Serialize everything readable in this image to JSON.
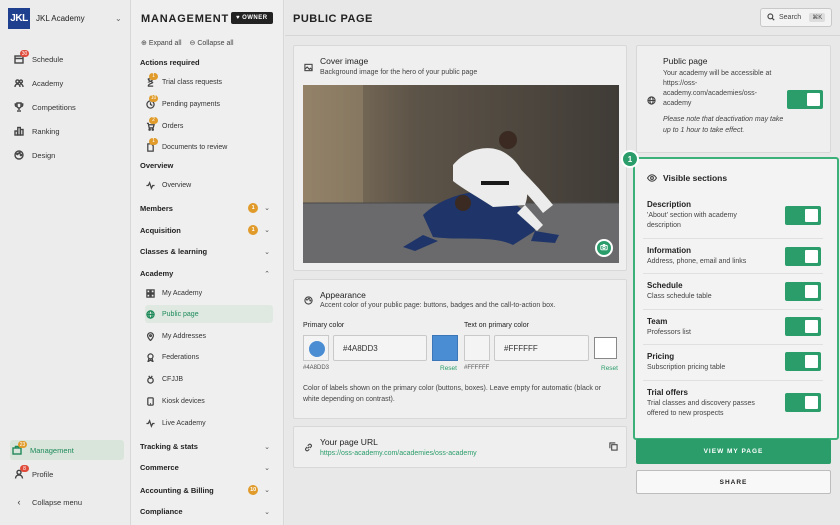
{
  "brand": {
    "logo_text": "JKL",
    "name": "JKL Academy"
  },
  "leftnav": [
    {
      "label": "Schedule",
      "badge": "30",
      "badge_color": "#e04a3a"
    },
    {
      "label": "Academy"
    },
    {
      "label": "Competitions"
    },
    {
      "label": "Ranking"
    },
    {
      "label": "Design"
    }
  ],
  "leftnav_bottom": {
    "management": {
      "label": "Management",
      "badge": "23"
    },
    "profile": {
      "label": "Profile",
      "badge": "8"
    },
    "collapse": {
      "label": "Collapse menu"
    }
  },
  "col2": {
    "title": "MANAGEMENT",
    "owner": "OWNER",
    "expand_all": "Expand all",
    "collapse_all": "Collapse all",
    "actions_label": "Actions required",
    "actions": [
      {
        "label": "Trial class requests",
        "badge": "1"
      },
      {
        "label": "Pending payments",
        "badge": "10"
      },
      {
        "label": "Orders",
        "badge": "2"
      },
      {
        "label": "Documents to review",
        "badge": "1"
      }
    ],
    "overview_label": "Overview",
    "overview_item": "Overview",
    "groups_top": [
      {
        "label": "Members",
        "badge": "1"
      },
      {
        "label": "Acquisition",
        "badge": "1"
      },
      {
        "label": "Classes & learning"
      }
    ],
    "academy_label": "Academy",
    "academy_items": [
      {
        "label": "My Academy"
      },
      {
        "label": "Public page"
      },
      {
        "label": "My Addresses"
      },
      {
        "label": "Federations"
      },
      {
        "label": "CFJJB"
      },
      {
        "label": "Kiosk devices"
      },
      {
        "label": "Live Academy"
      }
    ],
    "groups_bottom": [
      {
        "label": "Tracking & stats"
      },
      {
        "label": "Commerce"
      },
      {
        "label": "Accounting & Billing",
        "badge": "10"
      },
      {
        "label": "Compliance"
      }
    ]
  },
  "main": {
    "title": "PUBLIC PAGE",
    "search": {
      "label": "Search",
      "shortcut": "⌘K"
    },
    "cover": {
      "title": "Cover image",
      "subtitle": "Background image for the hero of your public page"
    },
    "appearance": {
      "title": "Appearance",
      "subtitle": "Accent color of your public page: buttons, badges and the call-to-action box.",
      "primary_label": "Primary color",
      "primary_value": "#4A8DD3",
      "primary_hex_small": "#4A8DD3",
      "text_label": "Text on primary color",
      "text_value": "#FFFFFF",
      "text_hex_small": "#FFFFFF",
      "reset": "Reset",
      "note": "Color of labels shown on the primary color (buttons, boxes). Leave empty for automatic (black or white depending on contrast)."
    },
    "url": {
      "title": "Your page URL",
      "value": "https://oss-academy.com/academies/oss-academy"
    },
    "public_page": {
      "title": "Public page",
      "text": "Your academy will be accessible at https://oss-academy.com/academies/oss-academy",
      "note": "Please note that deactivation may take up to 1 hour to take effect.",
      "enabled": true
    },
    "callout_number": "1",
    "visible_sections": {
      "title": "Visible sections",
      "items": [
        {
          "title": "Description",
          "desc": "'About' section with academy description",
          "enabled": true
        },
        {
          "title": "Information",
          "desc": "Address, phone, email and links",
          "enabled": true
        },
        {
          "title": "Schedule",
          "desc": "Class schedule table",
          "enabled": true
        },
        {
          "title": "Team",
          "desc": "Professors list",
          "enabled": true
        },
        {
          "title": "Pricing",
          "desc": "Subscription pricing table",
          "enabled": true
        },
        {
          "title": "Trial offers",
          "desc": "Trial classes and discovery passes offered to new prospects",
          "enabled": true
        }
      ]
    },
    "view_button": "VIEW MY PAGE",
    "share_button": "SHARE"
  },
  "colors": {
    "accent": "#2a9d6a",
    "primary_swatch": "#4A8DD3",
    "logo": "#1f3f8f"
  }
}
